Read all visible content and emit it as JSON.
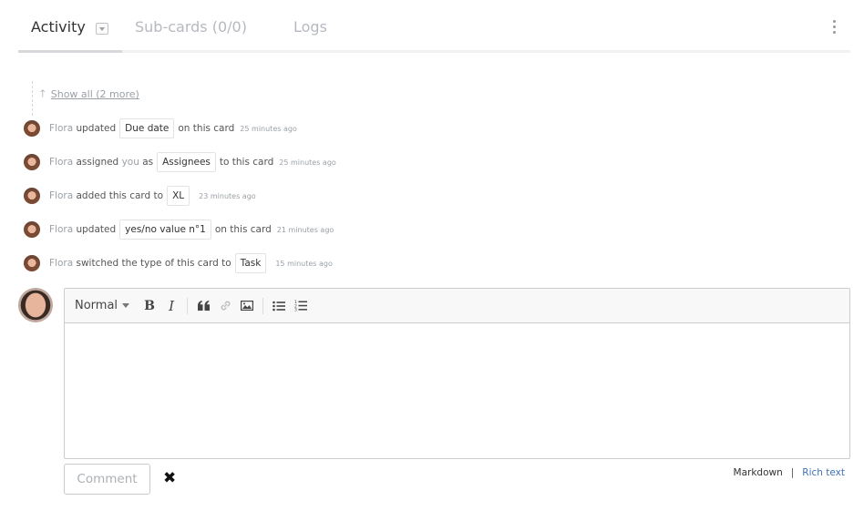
{
  "tabs": {
    "activity": "Activity",
    "subcards": "Sub-cards (0/0)",
    "logs": "Logs"
  },
  "timeline": {
    "show_all": "Show all (2 more)",
    "events": [
      {
        "user": "Flora",
        "before": "updated",
        "pill": "Due date",
        "after": "on this card",
        "time": "25 minutes ago"
      },
      {
        "user": "Flora",
        "before": "assigned",
        "you": "you",
        "as": "as",
        "pill": "Assignees",
        "after": "to this card",
        "time": "25 minutes ago"
      },
      {
        "user": "Flora",
        "before": "added this card to",
        "pill": "XL",
        "after": "",
        "time": "23 minutes ago"
      },
      {
        "user": "Flora",
        "before": "updated",
        "pill": "yes/no value n°1",
        "after": "on this card",
        "time": "21 minutes ago"
      },
      {
        "user": "Flora",
        "before": "switched the type of this card to",
        "pill": "Task",
        "after": "",
        "time": "15 minutes ago"
      }
    ]
  },
  "editor": {
    "format_label": "Normal",
    "bold_glyph": "B",
    "italic_glyph": "I",
    "quote_glyph": "❝",
    "link_glyph": "🔗",
    "image_glyph": "▣",
    "bullets_glyph": "☰",
    "numbers_glyph": "☷"
  },
  "actions": {
    "comment_label": "Comment",
    "cancel_glyph": "✖",
    "markdown": "Markdown",
    "separator": "|",
    "rich_text": "Rich text"
  },
  "colors": {
    "accent_link": "#3f73b8",
    "muted": "#9aa0a6"
  }
}
